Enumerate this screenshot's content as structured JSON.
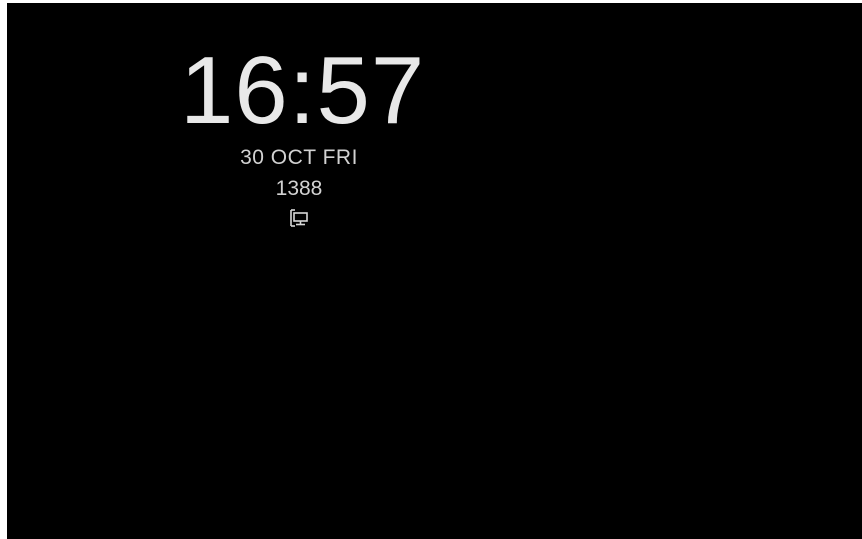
{
  "always_on_display": {
    "time": "16:57",
    "date": "30 OCT FRI",
    "counter": "1388",
    "status_icon": "network-monitor-icon"
  },
  "colors": {
    "background": "#000000",
    "text": "#d9d9d9"
  }
}
